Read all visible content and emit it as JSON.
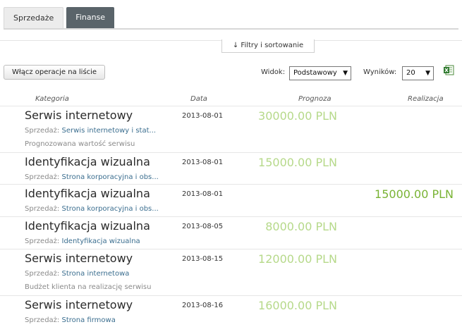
{
  "tabs": [
    {
      "label": "Sprzedaże",
      "active": false
    },
    {
      "label": "Finanse",
      "active": true
    }
  ],
  "filters_button": "↓ Filtry i sortowanie",
  "bulk_button": "Włącz operacje na liście",
  "view": {
    "label": "Widok:",
    "value": "Podstawowy"
  },
  "results": {
    "label": "Wyników:",
    "value": "20"
  },
  "export_icon": "excel-icon",
  "columns": {
    "category": "Kategoria",
    "date": "Data",
    "forecast": "Prognoza",
    "realization": "Realizacja"
  },
  "rows": [
    {
      "title": "Serwis internetowy",
      "sub_prefix": "Sprzedaż:",
      "sub_link": "Serwis internetowy i stat...",
      "note": "Prognozowana wartość serwisu",
      "date": "2013-08-01",
      "forecast": "30000.00 PLN",
      "realization": ""
    },
    {
      "title": "Identyfikacja wizualna",
      "sub_prefix": "Sprzedaż:",
      "sub_link": "Strona korporacyjna i obs...",
      "note": "",
      "date": "2013-08-01",
      "forecast": "15000.00 PLN",
      "realization": ""
    },
    {
      "title": "Identyfikacja wizualna",
      "sub_prefix": "Sprzedaż:",
      "sub_link": "Strona korporacyjna i obs...",
      "note": "",
      "date": "2013-08-01",
      "forecast": "",
      "realization": "15000.00 PLN"
    },
    {
      "title": "Identyfikacja wizualna",
      "sub_prefix": "Sprzedaż:",
      "sub_link": "Identyfikacja wizualna",
      "note": "",
      "date": "2013-08-05",
      "forecast": "8000.00 PLN",
      "realization": ""
    },
    {
      "title": "Serwis internetowy",
      "sub_prefix": "Sprzedaż:",
      "sub_link": "Strona internetowa",
      "note": "Budżet klienta na realizację serwisu",
      "date": "2013-08-15",
      "forecast": "12000.00 PLN",
      "realization": ""
    },
    {
      "title": "Serwis internetowy",
      "sub_prefix": "Sprzedaż:",
      "sub_link": "Strona firmowa",
      "note": "",
      "date": "2013-08-16",
      "forecast": "16000.00 PLN",
      "realization": ""
    }
  ]
}
